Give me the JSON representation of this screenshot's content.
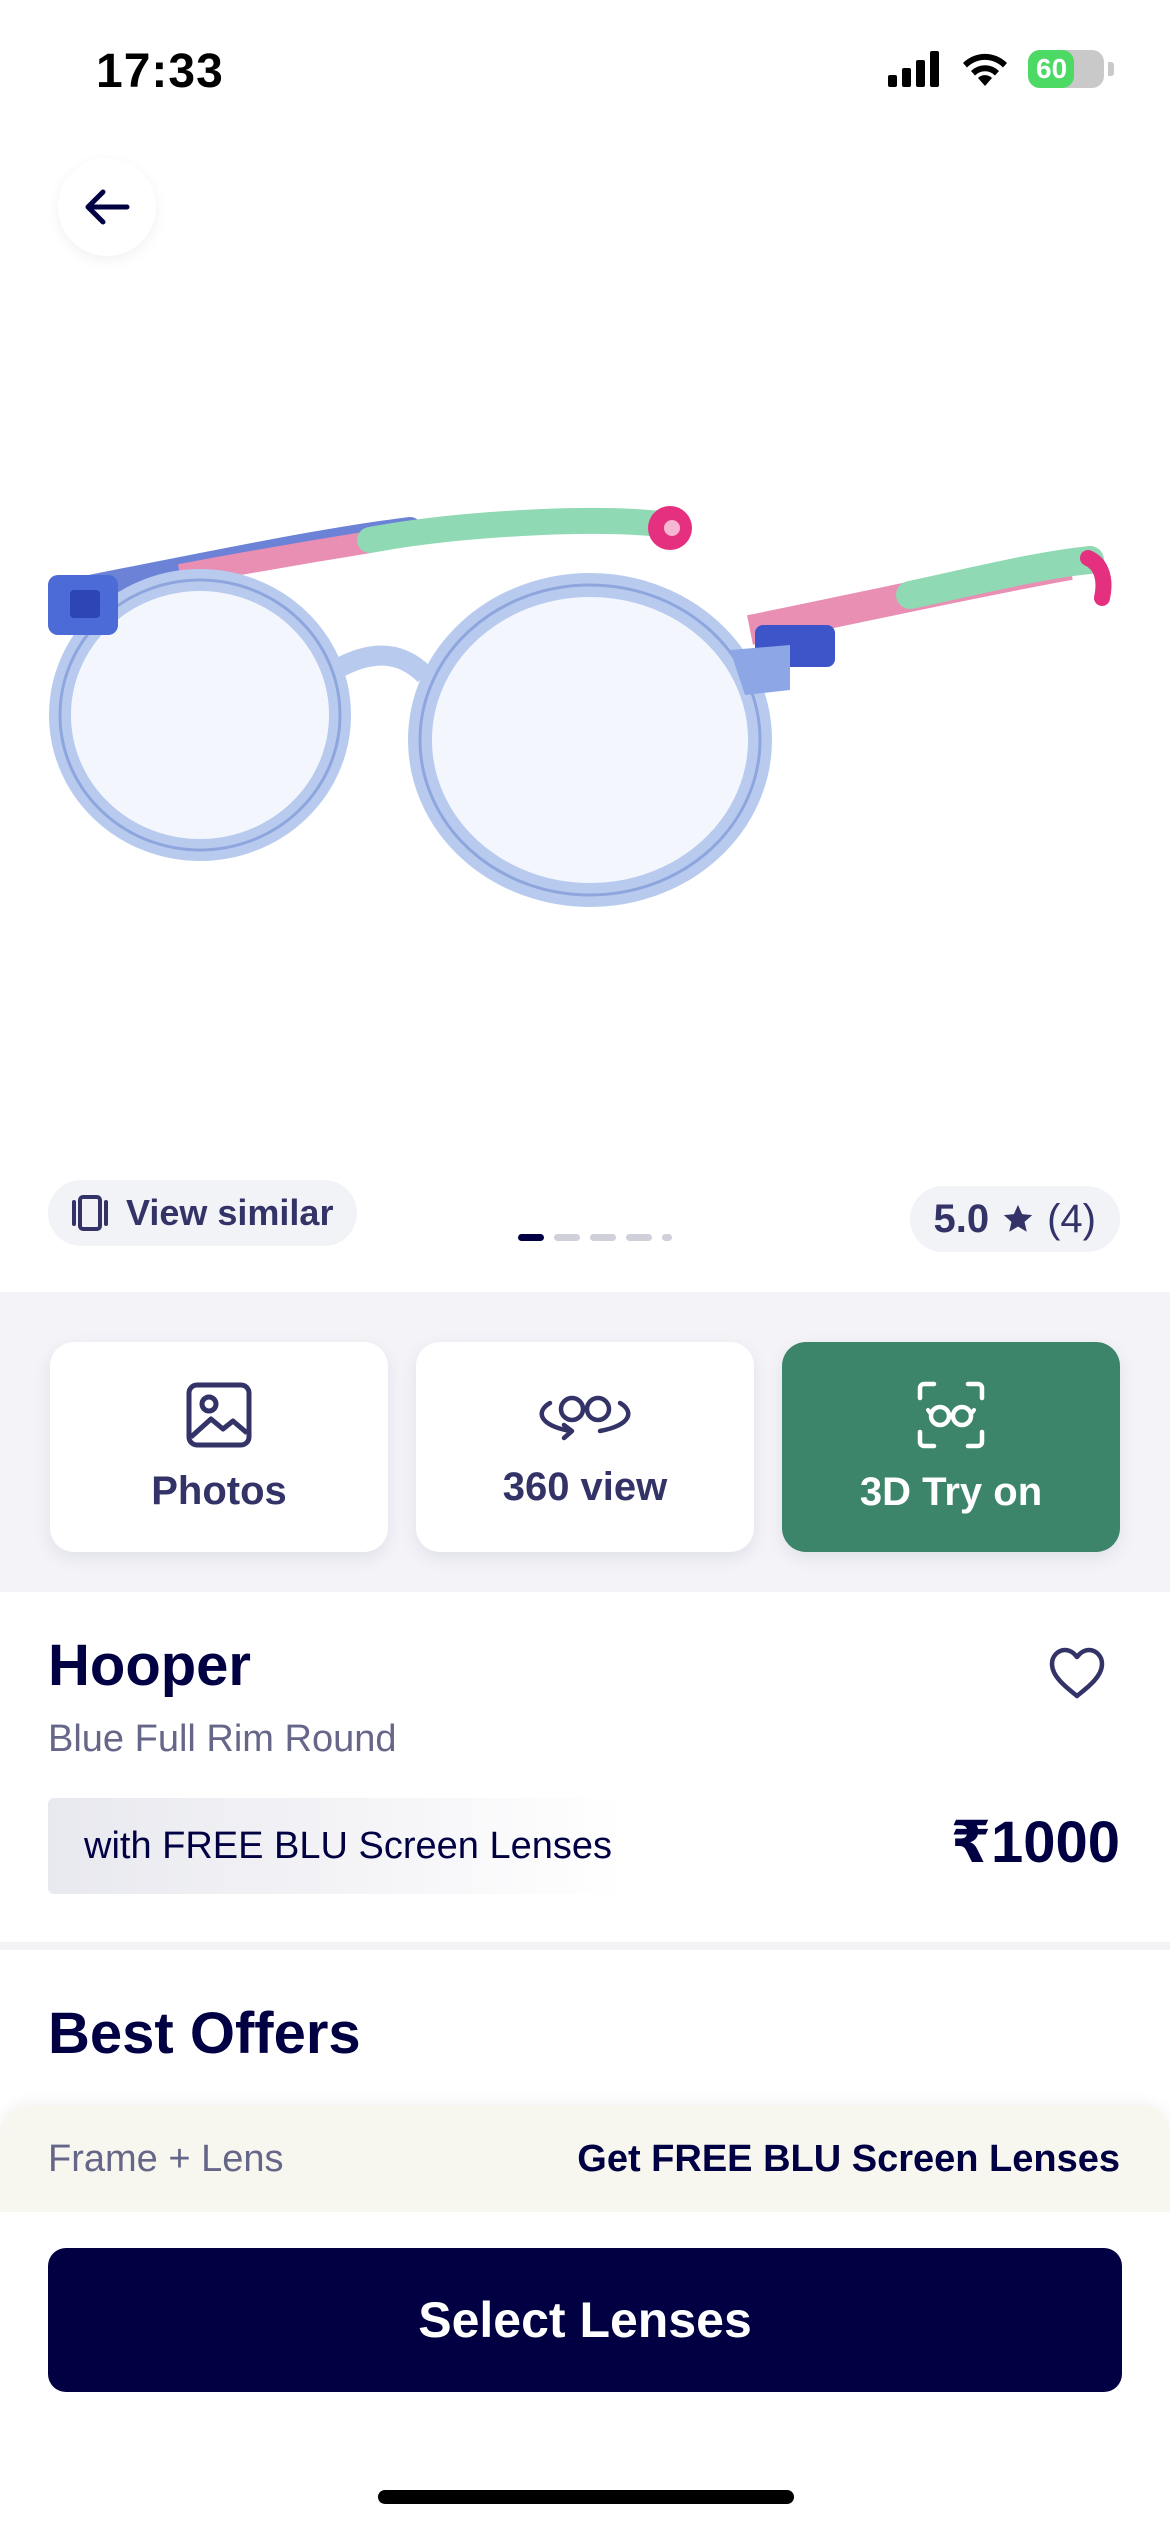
{
  "status_bar": {
    "time": "17:33",
    "battery": "60",
    "battery_level": 0.6
  },
  "gallery": {
    "view_similar_label": "View similar",
    "dots_count": 5,
    "active_dot": 0,
    "rating_score": "5.0",
    "rating_count": "(4)"
  },
  "view_options": [
    {
      "label": "Photos",
      "icon": "image-icon"
    },
    {
      "label": "360 view",
      "icon": "rotate-360-icon"
    },
    {
      "label": "3D Try on",
      "icon": "face-scan-glasses-icon"
    }
  ],
  "product": {
    "name": "Hooper",
    "subtitle": "Blue Full Rim Round",
    "lens_badge": "with FREE BLU Screen Lenses",
    "price": "₹1000"
  },
  "offers": {
    "title": "Best Offers",
    "row_left": "Frame + Lens",
    "row_right": "Get FREE BLU Screen Lenses"
  },
  "cta": {
    "label": "Select Lenses"
  },
  "colors": {
    "navy": "#000042",
    "accent_green": "#3c856b",
    "strip_bg": "#f3f3f8"
  }
}
